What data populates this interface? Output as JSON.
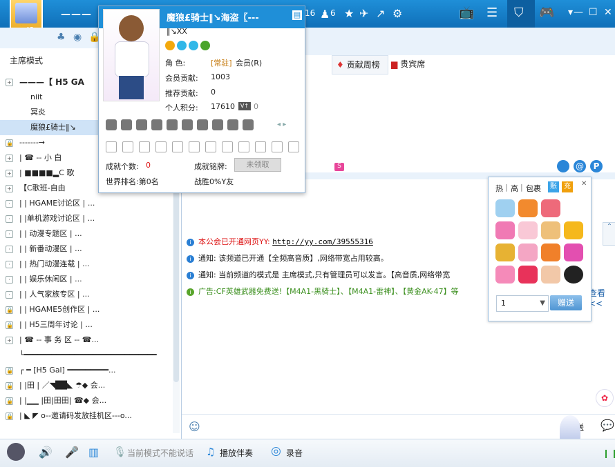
{
  "topbar": {
    "title": "——— 【",
    "counts": [
      "16",
      "6"
    ],
    "member_count": "42"
  },
  "left": {
    "mode_label": "主席模式",
    "tree": [
      {
        "icon": "+",
        "text": "———【 H5 GA"
      },
      {
        "icon": "",
        "text": "niit"
      },
      {
        "icon": "",
        "text": "冥炎"
      },
      {
        "icon": "",
        "text": "魔狼£骑士‖↘"
      },
      {
        "icon": "🔒",
        "text": "-------→"
      },
      {
        "icon": "+",
        "text": "|    ☎ -- 小 白"
      },
      {
        "icon": "+",
        "text": "|    ■■■■▂C 歌"
      },
      {
        "icon": "+",
        "text": "    【C歌班-自由"
      },
      {
        "icon": "·",
        "text": "|          |    HGAME讨论区   |    ..."
      },
      {
        "icon": "·",
        "text": "|          |单机游戏讨论区  |    ..."
      },
      {
        "icon": "·",
        "text": "|          |    动漫专题区    |    ..."
      },
      {
        "icon": "·",
        "text": "|          |    新番动漫区    |    ..."
      },
      {
        "icon": "·",
        "text": "|          |    热门动漫连载  |    ..."
      },
      {
        "icon": "·",
        "text": "|          |    娱乐休闲区    |    ..."
      },
      {
        "icon": "·",
        "text": "|          |    人气家族专区  |    ..."
      },
      {
        "icon": "🔒",
        "text": "|          |    HGAME5创作区  |    ..."
      },
      {
        "icon": "🔒",
        "text": "|          |    H5三周年讨论  |    ..."
      },
      {
        "icon": "+",
        "text": "|      ☎ -- 事 务 区 -- ☎..."
      },
      {
        "icon": "",
        "text": "└━━━━━━━━━━━━━━━━━━━━━━━━━━━━━"
      },
      {
        "icon": "🔒",
        "text": "┌ ═ [H5 Gal] ═════════..."
      },
      {
        "icon": "🔒",
        "text": "| |田 | ／◥██◣  ☂◆ 会..."
      },
      {
        "icon": "🔒",
        "text": "| |▁▁ |田|田田|  ☎◆ 会..."
      },
      {
        "icon": "🔒",
        "text": "| ◣ ◤ o--邀请码发放挂机区---o..."
      }
    ]
  },
  "popup": {
    "name": "魔狼£骑士‖↘海盗〖---",
    "name2": "‖↘ⅩⅩ",
    "role_label": "角    色:",
    "role_value_tag": "[常驻]",
    "role_value": "会员(R)",
    "contribution_label": "会员贡献:",
    "contribution_value": "1003",
    "recommend_label": "推荐贡献:",
    "recommend_value": "0",
    "points_label": "个人积分:",
    "points_value": "17610",
    "points_extra": "0",
    "achievements_label": "成就个数:",
    "achievements_value": "0",
    "medal_label": "成就铭牌:",
    "medal_value": "未领取",
    "world_rank": "世界排名:第0名",
    "battle": "战胜0%Y友"
  },
  "banner": {
    "tab_contrib": "贡献周榜",
    "tab_vip": "贵宾席"
  },
  "chat": {
    "messages": [
      {
        "prefix": "本公会已开通网页YY:",
        "link": "http://yy.com/39555316"
      },
      {
        "text": "通知: 该频道已开通【全频高音质】,网络带宽占用较高。"
      },
      {
        "text": "通知: 当前频道的模式是 主席模式,只有管理员可以发言。【高音质,网络带宽"
      },
      {
        "text": "广告:CF英雄武器免费送!【M4A1-黑骑士】、【M4A1-雷神】、【黄金AK-47】等",
        "more": "查看<<"
      }
    ]
  },
  "gift": {
    "tabs": [
      "热",
      "高",
      "包裹",
      "账",
      "充"
    ],
    "qty": "1",
    "send_label": "赠送"
  },
  "input": {
    "send_label": "发送"
  },
  "status": {
    "no_talk": "当前模式不能说话",
    "music": "播放伴奏",
    "record": "录音"
  },
  "colors": {
    "accent": "#1f8fd8",
    "red": "#dd1111",
    "green": "#3b8f1e"
  }
}
